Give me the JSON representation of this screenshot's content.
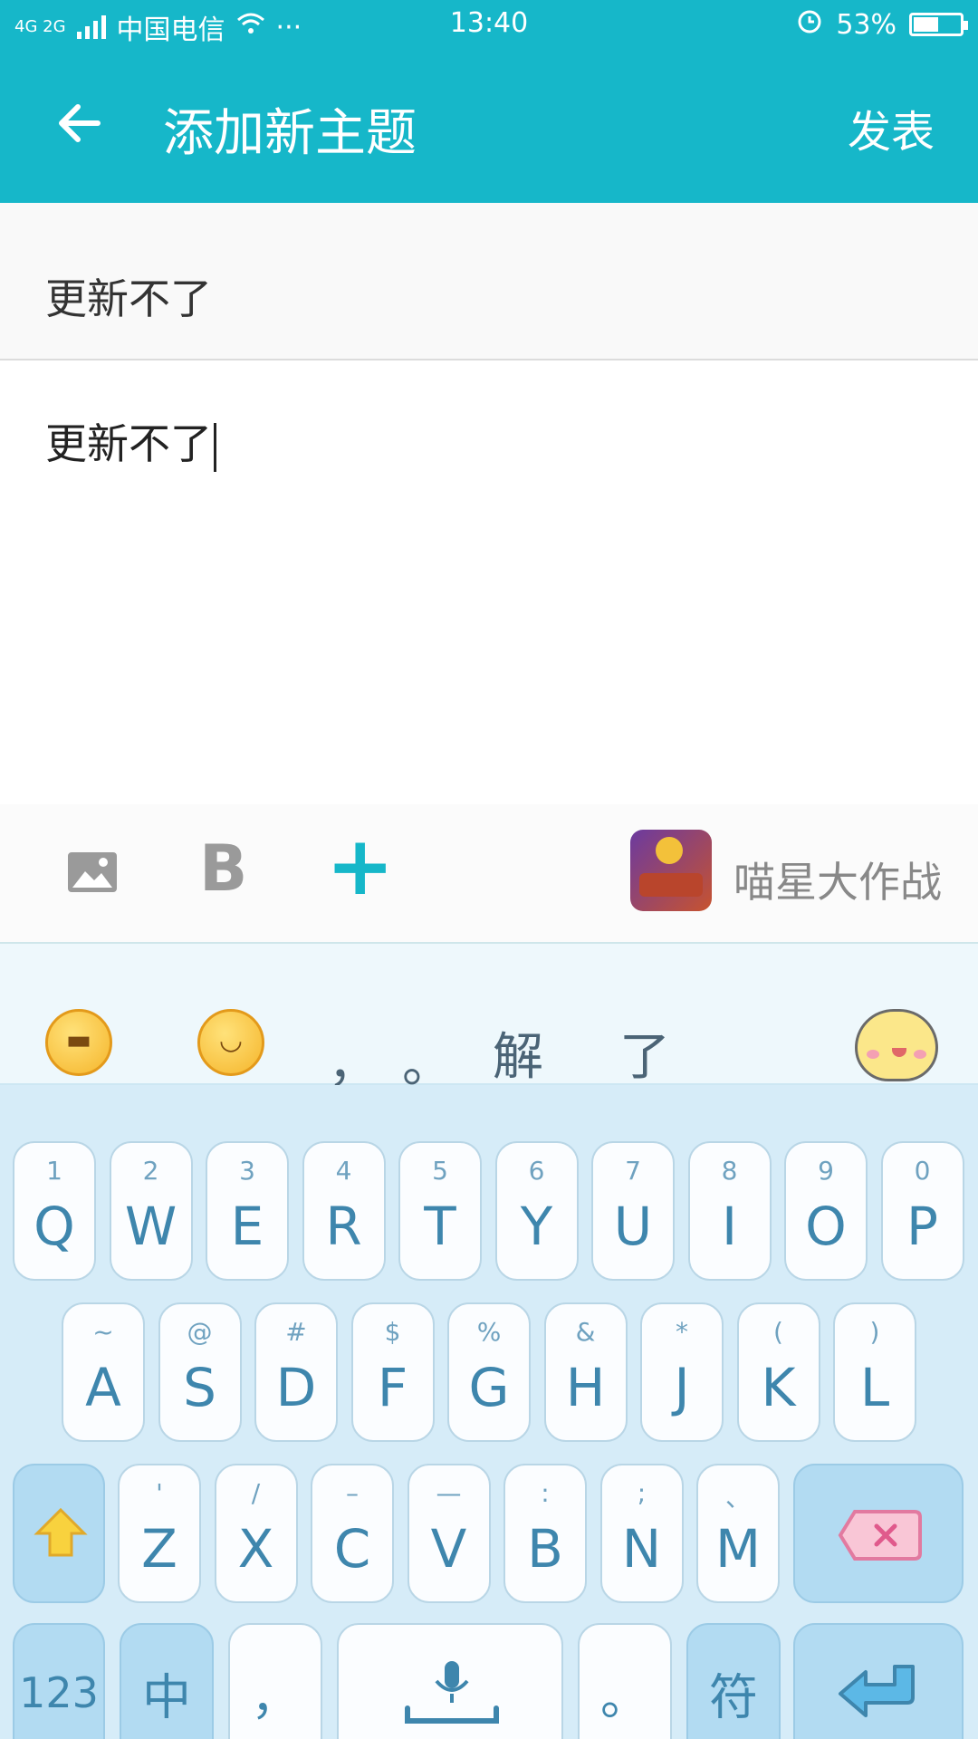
{
  "status": {
    "network": "4G 2G",
    "carrier": "中国电信",
    "more": "···",
    "time": "13:40",
    "battery": "53%",
    "battery_level": 0.53
  },
  "appbar": {
    "title": "添加新主题",
    "publish": "发表"
  },
  "subject": {
    "text": "更新不了"
  },
  "body": {
    "text": "更新不了"
  },
  "toolbar": {
    "icons": [
      "image-icon",
      "bold-icon",
      "plus-icon"
    ],
    "bold_label": "B",
    "plus_label": "+",
    "promo_label": "喵星大作战"
  },
  "keyboard": {
    "candidates": [
      "，",
      "。",
      "解",
      "了"
    ],
    "row1": [
      {
        "main": "Q",
        "sub": "1"
      },
      {
        "main": "W",
        "sub": "2"
      },
      {
        "main": "E",
        "sub": "3"
      },
      {
        "main": "R",
        "sub": "4"
      },
      {
        "main": "T",
        "sub": "5"
      },
      {
        "main": "Y",
        "sub": "6"
      },
      {
        "main": "U",
        "sub": "7"
      },
      {
        "main": "I",
        "sub": "8"
      },
      {
        "main": "O",
        "sub": "9"
      },
      {
        "main": "P",
        "sub": "0"
      }
    ],
    "row2": [
      {
        "main": "A",
        "sub": "~"
      },
      {
        "main": "S",
        "sub": "@"
      },
      {
        "main": "D",
        "sub": "#"
      },
      {
        "main": "F",
        "sub": "$"
      },
      {
        "main": "G",
        "sub": "%"
      },
      {
        "main": "H",
        "sub": "&"
      },
      {
        "main": "J",
        "sub": "*"
      },
      {
        "main": "K",
        "sub": "("
      },
      {
        "main": "L",
        "sub": ")"
      }
    ],
    "row3": [
      {
        "main": "Z",
        "sub": "'"
      },
      {
        "main": "X",
        "sub": "/"
      },
      {
        "main": "C",
        "sub": "–"
      },
      {
        "main": "V",
        "sub": "—"
      },
      {
        "main": "B",
        "sub": ":"
      },
      {
        "main": "N",
        "sub": ";"
      },
      {
        "main": "M",
        "sub": "、"
      }
    ],
    "bottom": {
      "num": "123",
      "lang": "中",
      "comma": "，",
      "period": "。",
      "symbols": "符"
    },
    "accent": "#16b7c9"
  }
}
